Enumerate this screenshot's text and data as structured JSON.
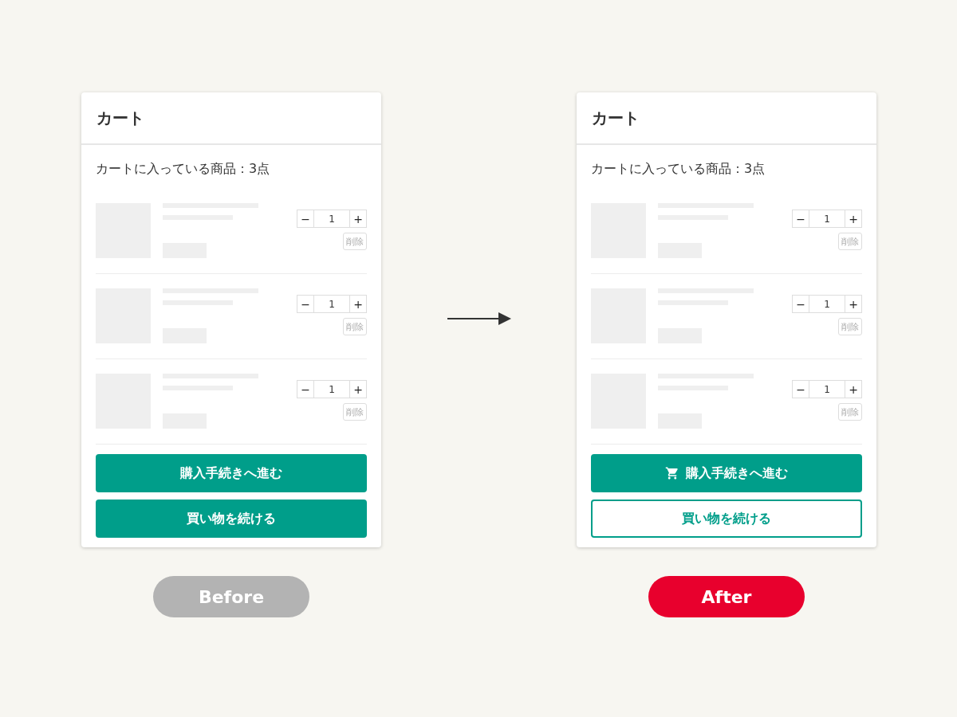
{
  "panels": [
    {
      "title": "カート",
      "summary": "カートに入っている商品：3点",
      "items": [
        {
          "minus": "−",
          "quantity": "1",
          "plus": "+",
          "remove": "削除"
        },
        {
          "minus": "−",
          "quantity": "1",
          "plus": "+",
          "remove": "削除"
        },
        {
          "minus": "−",
          "quantity": "1",
          "plus": "+",
          "remove": "削除"
        }
      ],
      "buttons": [
        {
          "label": "購入手続きへ進む",
          "kind": "filled"
        },
        {
          "label": "買い物を続ける",
          "kind": "filled"
        }
      ],
      "caption": {
        "label": "Before",
        "color": "#b3b3b3"
      }
    },
    {
      "title": "カート",
      "summary": "カートに入っている商品：3点",
      "items": [
        {
          "minus": "−",
          "quantity": "1",
          "plus": "+",
          "remove": "削除"
        },
        {
          "minus": "−",
          "quantity": "1",
          "plus": "+",
          "remove": "削除"
        },
        {
          "minus": "−",
          "quantity": "1",
          "plus": "+",
          "remove": "削除"
        }
      ],
      "buttons": [
        {
          "label": "購入手続きへ進む",
          "kind": "filled_cart"
        },
        {
          "label": "買い物を続ける",
          "kind": "outline"
        }
      ],
      "caption": {
        "label": "After",
        "color": "#e8002d"
      }
    }
  ]
}
